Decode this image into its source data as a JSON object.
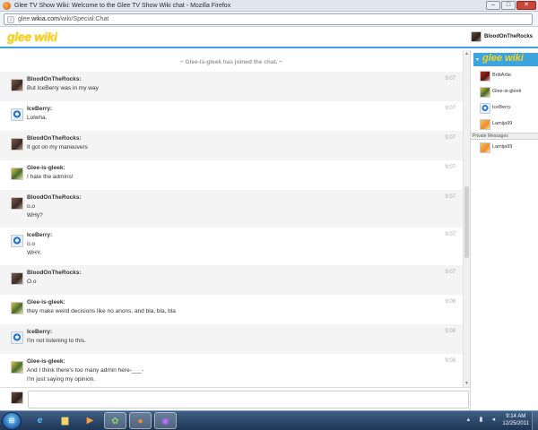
{
  "window": {
    "title": "Glee TV Show Wiki: Welcome to the Glee TV Show Wiki chat - Mozilla Firefox",
    "minimize": "–",
    "maximize": "□",
    "close": "✕"
  },
  "address_bar": {
    "url_prefix": "glee.",
    "url_domain": "wikia.com",
    "url_path": "/wiki/Special:Chat"
  },
  "header": {
    "logo": "glee wiki",
    "current_user": "BloodOnTheRocks"
  },
  "chat": {
    "join_notice": "~ Glee-is-gleek has joined the chat. ~",
    "messages": [
      {
        "user": "BloodOnTheRocks:",
        "time": "9:07",
        "lines": [
          "But IceBerry was in my way"
        ]
      },
      {
        "user": "IceBerry:",
        "time": "9:07",
        "lines": [
          "Lolwha."
        ]
      },
      {
        "user": "BloodOnTheRocks:",
        "time": "9:07",
        "lines": [
          "It got on my maneuvers"
        ]
      },
      {
        "user": "Glee-is-gleek:",
        "time": "9:07",
        "lines": [
          "I hate the admins!"
        ]
      },
      {
        "user": "BloodOnTheRocks:",
        "time": "9:07",
        "lines": [
          "o.o",
          "WHy?"
        ]
      },
      {
        "user": "IceBerry:",
        "time": "9:07",
        "lines": [
          "o.o",
          "WHY."
        ]
      },
      {
        "user": "BloodOnTheRocks:",
        "time": "9:07",
        "lines": [
          "O.o"
        ]
      },
      {
        "user": "Glee-is-gleek:",
        "time": "9:08",
        "lines": [
          "they make weird decisions like no anons, and bla, bla, bla"
        ]
      },
      {
        "user": "IceBerry:",
        "time": "9:08",
        "lines": [
          "I'm not listening to this."
        ]
      },
      {
        "user": "Glee-is-gleek:",
        "time": "9:08",
        "lines": [
          "And I think there's too many admin here-___-",
          "I'm just saying my opinion."
        ]
      }
    ]
  },
  "sidebar": {
    "wordmark": "glee wiki",
    "users": [
      "BrittArtie",
      "Glee-is-gleek",
      "IceBerry",
      "Lamija99"
    ],
    "private_messages_label": "Private Messages",
    "private_users": [
      "Lamija99"
    ]
  },
  "taskbar": {
    "time": "9:14 AM",
    "date": "12/25/2011"
  },
  "icons": {
    "start": "windows-start-icon",
    "ie": "internet-explorer-icon",
    "explorer": "folder-icon",
    "media": "media-player-icon",
    "messenger": "messenger-icon",
    "firefox": "firefox-icon",
    "other": "purple-orb-icon"
  },
  "colors": {
    "accent": "#3ea4df",
    "logo": "#f7d51d",
    "alt_row": "#f4f4f4"
  }
}
